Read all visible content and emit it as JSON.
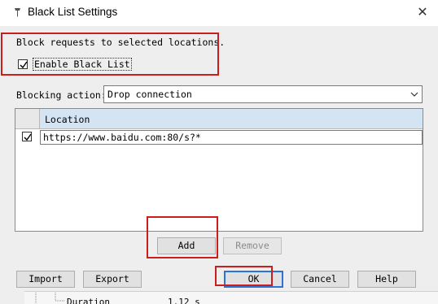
{
  "window": {
    "title": "Black List Settings",
    "close_glyph": "✕"
  },
  "dialog": {
    "description": "Block requests to selected locations.",
    "enable_checkbox": {
      "label": "Enable Black List",
      "checked": true
    },
    "blocking_action": {
      "label": "Blocking action:",
      "selected": "Drop connection"
    },
    "table": {
      "columns": [
        "Location"
      ],
      "rows": [
        {
          "checked": true,
          "location": "https://www.baidu.com:80/s?*"
        }
      ]
    },
    "buttons": {
      "add": "Add",
      "remove": "Remove",
      "import": "Import",
      "export": "Export",
      "ok": "OK",
      "cancel": "Cancel",
      "help": "Help"
    }
  },
  "background_window": {
    "label": "Duration",
    "value": "1.12 s"
  },
  "colors": {
    "highlight": "#c81e1e",
    "header_selected": "#d5e4f3",
    "default_button_border": "#2b73d6"
  }
}
